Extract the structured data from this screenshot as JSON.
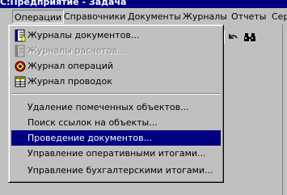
{
  "window": {
    "title": "С:Предприятие - Задача"
  },
  "menubar": {
    "items": [
      {
        "label": "Операции",
        "open": true
      },
      {
        "label": "Справочники"
      },
      {
        "label": "Документы"
      },
      {
        "label": "Журналы"
      },
      {
        "label": "Отчеты"
      },
      {
        "label": "Сер"
      }
    ]
  },
  "toolbar": {
    "icons": [
      "undo-arrow-icon",
      "binoculars-icon"
    ]
  },
  "dropdown": {
    "group1": [
      {
        "label": "Журналы документов...",
        "icon": "document-journal-icon",
        "disabled": false
      },
      {
        "label": "Журналы расчетов...",
        "icon": "calculation-journal-icon",
        "disabled": true
      },
      {
        "label": "Журнал операций",
        "icon": "operations-journal-icon",
        "disabled": false
      },
      {
        "label": "Журнал проводок",
        "icon": "entries-journal-icon",
        "disabled": false
      }
    ],
    "group2": [
      {
        "label": "Удаление помеченных объектов...",
        "selected": false
      },
      {
        "label": "Поиск ссылок на объекты...",
        "selected": false
      },
      {
        "label": "Проведение документов...",
        "selected": true
      },
      {
        "label": "Управление оперативными итогами...",
        "selected": false
      },
      {
        "label": "Управление бухгалтерскими итогами...",
        "selected": false
      }
    ]
  }
}
